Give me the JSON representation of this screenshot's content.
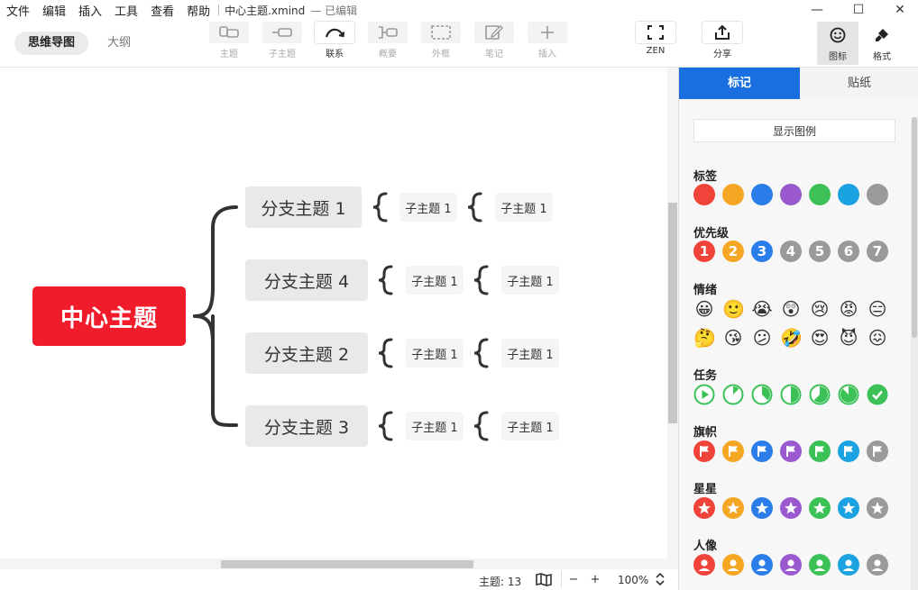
{
  "menu": [
    "文件",
    "编辑",
    "插入",
    "工具",
    "查看",
    "帮助"
  ],
  "file_title": "中心主题.xmind",
  "edit_state": "— 已编辑",
  "window_controls": {
    "minimize": "—",
    "maximize": "☐",
    "close": "✕"
  },
  "view_tabs": {
    "mindmap": "思维导图",
    "outline": "大纲"
  },
  "tools": [
    {
      "label": "主题",
      "icon": "topic-icon",
      "enabled": false
    },
    {
      "label": "子主题",
      "icon": "subtopic-icon",
      "enabled": false
    },
    {
      "label": "联系",
      "icon": "relationship-icon",
      "enabled": true
    },
    {
      "label": "概要",
      "icon": "summary-icon",
      "enabled": false
    },
    {
      "label": "外框",
      "icon": "boundary-icon",
      "enabled": false
    },
    {
      "label": "笔记",
      "icon": "notes-icon",
      "enabled": false
    },
    {
      "label": "插入",
      "icon": "plus-icon",
      "enabled": false
    }
  ],
  "zen_label": "ZEN",
  "share_label": "分享",
  "icon_panel_label": "图标",
  "format_panel_label": "格式",
  "mindmap": {
    "central": "中心主题",
    "branches": [
      {
        "label": "分支主题 1",
        "sub1": "子主题 1",
        "sub2": "子主题 1"
      },
      {
        "label": "分支主题 4",
        "sub1": "子主题 1",
        "sub2": "子主题 1"
      },
      {
        "label": "分支主题 2",
        "sub1": "子主题 1",
        "sub2": "子主题 1"
      },
      {
        "label": "分支主题 3",
        "sub1": "子主题 1",
        "sub2": "子主题 1"
      }
    ]
  },
  "status": {
    "topic_count": "主题: 13",
    "zoom": "100%",
    "zoom_out": "−",
    "zoom_in": "+"
  },
  "panel": {
    "tabs": {
      "markers": "标记",
      "stickers": "贴纸"
    },
    "show_legend": "显示图例",
    "sections": {
      "labels": "标签",
      "priority": "优先级",
      "emotion": "情绪",
      "task": "任务",
      "flag": "旗帜",
      "star": "星星",
      "people": "人像"
    },
    "colors": [
      "#f0443b",
      "#f5a623",
      "#2b7de9",
      "#9b59d0",
      "#3cc157",
      "#1aa3e0",
      "#9a9a9a"
    ],
    "priority_numbers": [
      "1",
      "2",
      "3",
      "4",
      "5",
      "6",
      "7"
    ],
    "priority_colors": [
      "#f0443b",
      "#f5a623",
      "#2b7de9",
      "#9a9a9a",
      "#9a9a9a",
      "#9a9a9a",
      "#9a9a9a"
    ],
    "emotion_row1": [
      "😀",
      "🙂",
      "😭",
      "😲",
      "😢",
      "😡",
      "😑"
    ],
    "emotion_row2": [
      "🤔",
      "😘",
      "😕",
      "🤣",
      "😍",
      "😈",
      "😖"
    ],
    "task_color": "#3cc157"
  }
}
